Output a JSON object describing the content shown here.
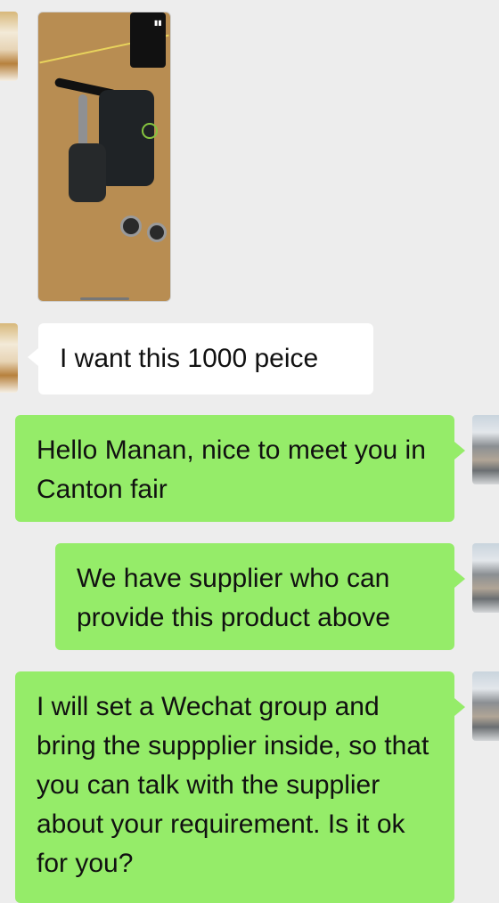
{
  "chat": {
    "messages": [
      {
        "side": "left",
        "type": "video",
        "avatar": "customer-avatar"
      },
      {
        "side": "left",
        "type": "text",
        "text": "I want this 1000 peice"
      },
      {
        "side": "right",
        "type": "text",
        "text": "Hello Manan, nice to meet you in Canton fair"
      },
      {
        "side": "right",
        "type": "text",
        "text": "We have supplier who can provide this product above"
      },
      {
        "side": "right",
        "type": "text",
        "text": "I will set a Wechat group and bring the suppplier inside, so that you can talk with the supplier about your requirement. Is it ok for you?"
      }
    ]
  },
  "colors": {
    "background": "#ededed",
    "incoming_bubble": "#ffffff",
    "outgoing_bubble": "#95ec69"
  }
}
